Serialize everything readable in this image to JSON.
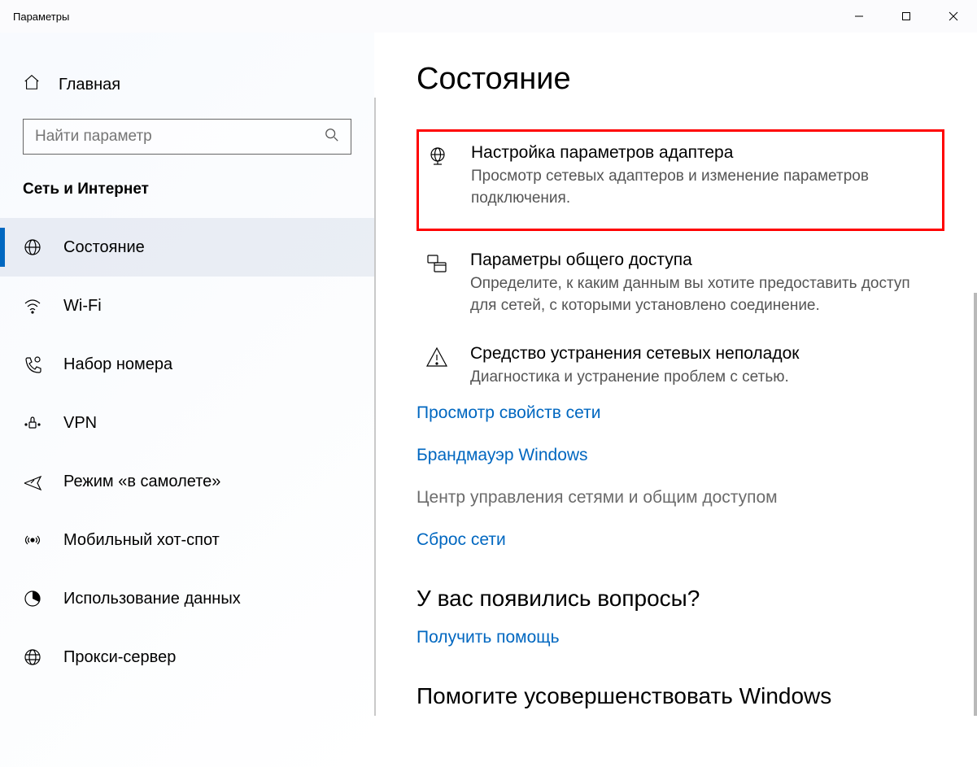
{
  "window": {
    "title": "Параметры"
  },
  "sidebar": {
    "home_label": "Главная",
    "search_placeholder": "Найти параметр",
    "category": "Сеть и Интернет",
    "items": [
      {
        "label": "Состояние",
        "active": true,
        "icon": "globe"
      },
      {
        "label": "Wi-Fi",
        "active": false,
        "icon": "wifi"
      },
      {
        "label": "Набор номера",
        "active": false,
        "icon": "dial"
      },
      {
        "label": "VPN",
        "active": false,
        "icon": "vpn"
      },
      {
        "label": "Режим «в самолете»",
        "active": false,
        "icon": "airplane"
      },
      {
        "label": "Мобильный хот-спот",
        "active": false,
        "icon": "hotspot"
      },
      {
        "label": "Использование данных",
        "active": false,
        "icon": "datausage"
      },
      {
        "label": "Прокси-сервер",
        "active": false,
        "icon": "proxy"
      }
    ]
  },
  "main": {
    "page_title": "Состояние",
    "settings": [
      {
        "title": "Настройка параметров адаптера",
        "desc": "Просмотр сетевых адаптеров и изменение параметров подключения.",
        "highlight": true,
        "icon": "adapter"
      },
      {
        "title": "Параметры общего доступа",
        "desc": "Определите, к каким данным вы хотите предоставить доступ для сетей, с которыми установлено соединение.",
        "highlight": false,
        "icon": "sharing"
      },
      {
        "title": "Средство устранения сетевых неполадок",
        "desc": "Диагностика и устранение проблем с сетью.",
        "highlight": false,
        "icon": "troubleshoot"
      }
    ],
    "links": [
      {
        "label": "Просмотр свойств сети",
        "disabled": false
      },
      {
        "label": "Брандмауэр Windows",
        "disabled": false
      },
      {
        "label": "Центр управления сетями и общим доступом",
        "disabled": true
      },
      {
        "label": "Сброс сети",
        "disabled": false
      }
    ],
    "questions_heading": "У вас появились вопросы?",
    "help_link": "Получить помощь",
    "improve_heading": "Помогите усовершенствовать Windows"
  }
}
